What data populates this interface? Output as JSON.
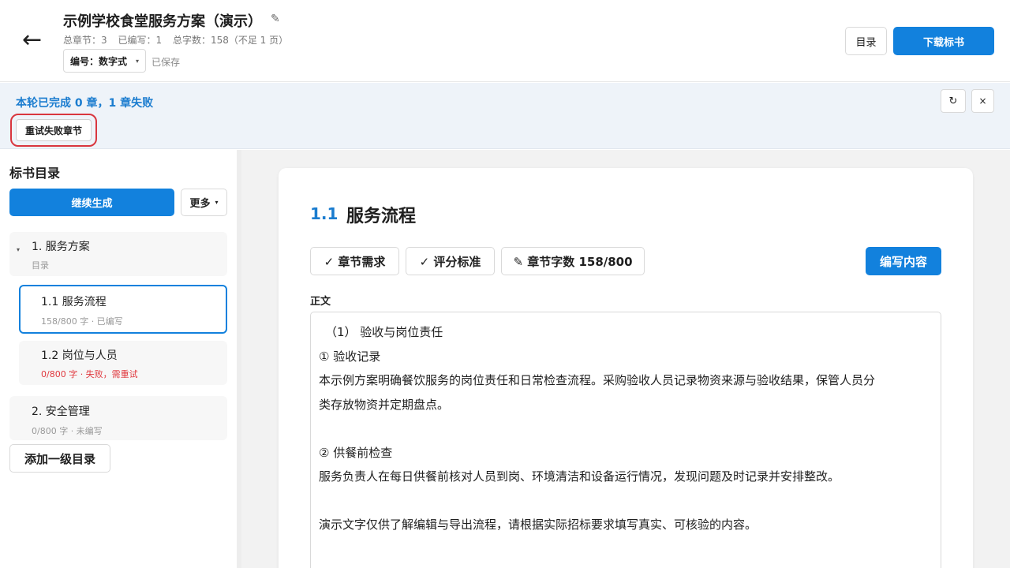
{
  "header": {
    "back_icon": "←",
    "title": "示例学校食堂服务方案（演示）",
    "edit_icon": "✎",
    "stats": {
      "chapters": "总章节：3",
      "written": "已编写：1",
      "words": "总字数：158（不足 1 页）"
    },
    "numbering": {
      "label": "编号：数字式",
      "caret": "▾"
    },
    "saved": "已保存",
    "toc_button": "目录",
    "download_button": "下载标书"
  },
  "banner": {
    "message": "本轮已完成 0 章，1 章失败",
    "retry_button": "重试失败章节",
    "refresh_icon": "↻",
    "close_icon": "×"
  },
  "sidebar": {
    "title": "标书目录",
    "continue_button": "继续生成",
    "more_button": "更多",
    "more_caret": "▾",
    "toc_caret": "▾",
    "items": [
      {
        "title": "1. 服务方案",
        "sub": "目录"
      },
      {
        "title": "1.1 服务流程",
        "sub": "158/800 字 · 已编写"
      },
      {
        "title": "1.2 岗位与人员",
        "sub": "0/800 字 · 失败，需重试"
      },
      {
        "title": "2. 安全管理",
        "sub": "0/800 字 · 未编写"
      }
    ],
    "add_button": "添加一级目录"
  },
  "main": {
    "section_number": "1.1",
    "section_title": "服务流程",
    "chips": {
      "requirements": "✓ 章节需求",
      "criteria": "✓ 评分标准",
      "wordcount": "✎ 章节字数 158/800"
    },
    "write_button": "编写内容",
    "body_label": "正文",
    "paragraphs": [
      "（1） 验收与岗位责任",
      "① 验收记录",
      "本示例方案明确餐饮服务的岗位责任和日常检查流程。采购验收人员记录物资来源与验收结果，保管人员分",
      "类存放物资并定期盘点。",
      "",
      "② 供餐前检查",
      "服务负责人在每日供餐前核对人员到岗、环境清洁和设备运行情况，发现问题及时记录并安排整改。",
      "",
      "演示文字仅供了解编辑与导出流程，请根据实际招标要求填写真实、可核验的内容。"
    ]
  },
  "colors": {
    "accent": "#1281dd",
    "error": "#e0383e",
    "highlight_ring": "#d9363e",
    "banner_bg": "#eef3f9"
  }
}
